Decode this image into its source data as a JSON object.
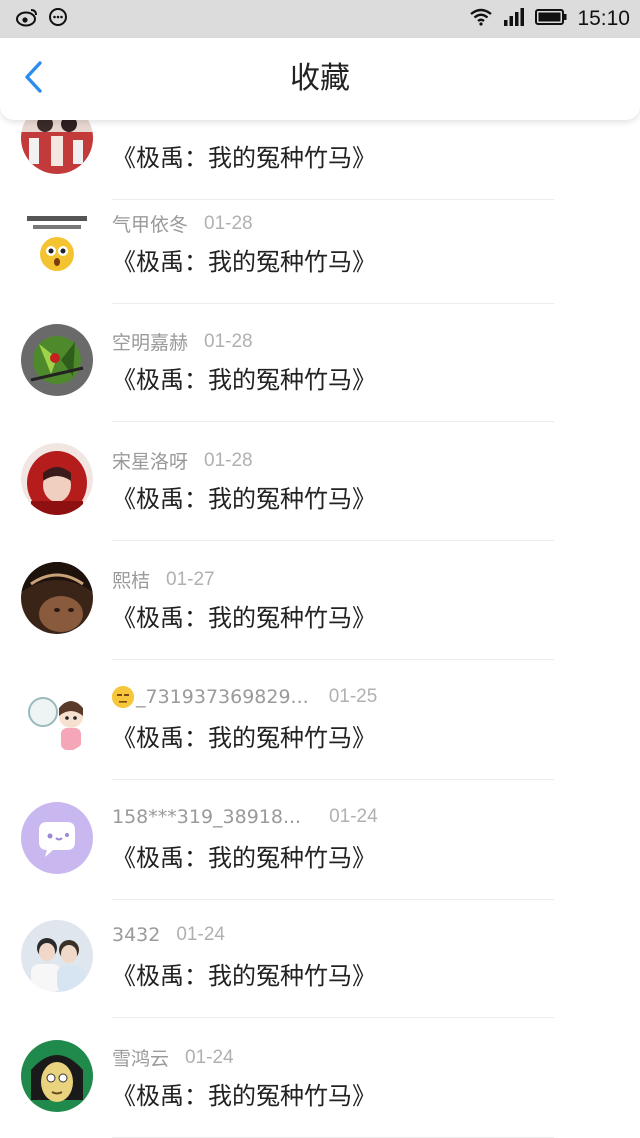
{
  "status_bar": {
    "time": "15:10",
    "icons": [
      "weibo-icon",
      "message-dots-icon",
      "wifi-icon",
      "signal-icon",
      "battery-icon"
    ]
  },
  "header": {
    "back_icon": "chevron-left-icon",
    "title": "收藏",
    "accent_color": "#2d8cf0"
  },
  "items": [
    {
      "name": "",
      "date": "",
      "title": "《极禹：我的冤种竹马》",
      "avatar": "avatar-photo-red"
    },
    {
      "name": "气甲依冬",
      "date": "01-28",
      "title": "《极禹：我的冤种竹马》",
      "avatar": "avatar-emoji-meme"
    },
    {
      "name": "空明嘉赫",
      "date": "01-28",
      "title": "《极禹：我的冤种竹马》",
      "avatar": "avatar-green-cartoon"
    },
    {
      "name": "宋星洛呀",
      "date": "01-28",
      "title": "《极禹：我的冤种竹马》",
      "avatar": "avatar-red-hood"
    },
    {
      "name": "熙桔",
      "date": "01-27",
      "title": "《极禹：我的冤种竹马》",
      "avatar": "avatar-dark-portrait"
    },
    {
      "name": "_731937369829...",
      "date": "01-25",
      "title": "《极禹：我的冤种竹马》",
      "avatar": "avatar-cartoon-girl",
      "name_prefix_icon": "unamused-emoji-icon"
    },
    {
      "name": "158***319_38918...",
      "date": "01-24",
      "title": "《极禹：我的冤种竹马》",
      "avatar": "avatar-purple-default"
    },
    {
      "name": "3432",
      "date": "01-24",
      "title": "《极禹：我的冤种竹马》",
      "avatar": "avatar-two-people"
    },
    {
      "name": "雪鸿云",
      "date": "01-24",
      "title": "《极禹：我的冤种竹马》",
      "avatar": "avatar-anime-boy"
    }
  ]
}
